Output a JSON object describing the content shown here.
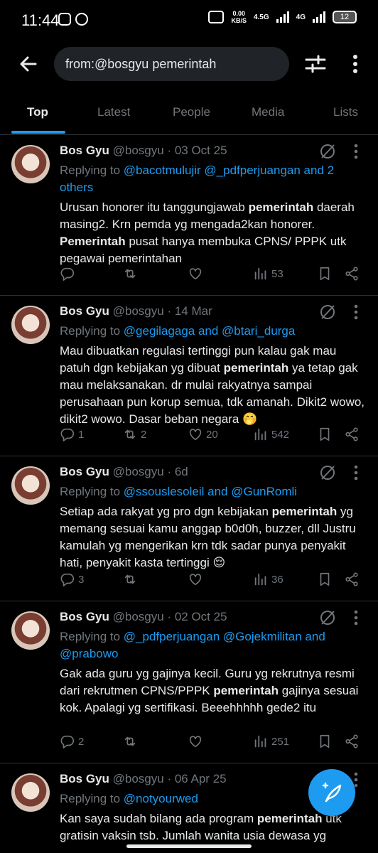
{
  "status": {
    "time": "11:44",
    "kbs_value": "0.00",
    "kbs_unit": "KB/S",
    "net1": "4.5G",
    "net2": "4G",
    "battery": "12"
  },
  "search": {
    "query": "from:@bosgyu pemerintah"
  },
  "tabs": [
    "Top",
    "Latest",
    "People",
    "Media",
    "Lists"
  ],
  "colors": {
    "accent": "#1d9bf0",
    "background": "#000000",
    "muted": "#71767b"
  },
  "tweets": [
    {
      "name": "Bos Gyu",
      "meta": "@bosgyu · 03 Oct 25",
      "replying_prefix": "Replying to ",
      "replying_to": "@bacotmulujir @_pdfperjuangan and 2 others",
      "body": [
        {
          "t": "Urusan honorer itu tanggungjawab "
        },
        {
          "b": "pemerintah"
        },
        {
          "t": " daerah masing2. Krn pemda yg mengada2kan honorer. "
        },
        {
          "b": "Pemerintah"
        },
        {
          "t": " pusat hanya membuka CPNS/ PPPK utk pegawai pemerintahan"
        }
      ],
      "replies": "",
      "reposts": "",
      "likes": "",
      "views": "53"
    },
    {
      "name": "Bos Gyu",
      "meta": "@bosgyu · 14 Mar",
      "replying_prefix": "Replying to ",
      "replying_to": "@gegilagaga and @btari_durga",
      "body": [
        {
          "t": "Mau dibuatkan regulasi tertinggi pun kalau gak mau patuh dgn kebijakan yg dibuat "
        },
        {
          "b": "pemerintah"
        },
        {
          "t": " ya tetap gak mau melaksanakan. dr mulai rakyatnya sampai perusahaan pun korup semua, tdk amanah. Dikit2 wowo, dikit2 wowo. Dasar beban negara 🤭"
        }
      ],
      "replies": "1",
      "reposts": "2",
      "likes": "20",
      "views": "542"
    },
    {
      "name": "Bos Gyu",
      "meta": "@bosgyu · 6d",
      "replying_prefix": "Replying to ",
      "replying_to": "@ssouslesoleil and @GunRomli",
      "body": [
        {
          "t": "Setiap ada rakyat yg pro dgn kebijakan "
        },
        {
          "b": "pemerintah"
        },
        {
          "t": " yg memang sesuai kamu anggap b0d0h, buzzer, dll Justru kamulah yg mengerikan krn tdk sadar punya penyakit hati, penyakit kasta tertinggi 😌"
        }
      ],
      "replies": "3",
      "reposts": "",
      "likes": "",
      "views": "36"
    },
    {
      "name": "Bos Gyu",
      "meta": "@bosgyu · 02 Oct 25",
      "replying_prefix": "Replying to ",
      "replying_to": "@_pdfperjuangan @Gojekmilitan and @prabowo",
      "body": [
        {
          "t": "Gak ada guru yg gajinya kecil. Guru yg rekrutnya resmi dari rekrutmen CPNS/PPPK "
        },
        {
          "b": "pemerintah"
        },
        {
          "t": " gajinya sesuai kok. Apalagi yg sertifikasi. Beeehhhhh gede2 itu"
        }
      ],
      "replies": "2",
      "reposts": "",
      "likes": "",
      "views": "251"
    },
    {
      "name": "Bos Gyu",
      "meta": "@bosgyu · 06 Apr 25",
      "replying_prefix": "Replying to ",
      "replying_to": "@notyourwed",
      "body": [
        {
          "t": "Kan saya sudah bilang ada program "
        },
        {
          "b": "pemerintah"
        },
        {
          "t": " utk gratisin vaksin tsb. Jumlah wanita usia dewasa yg"
        }
      ],
      "replies": "",
      "reposts": "",
      "likes": "",
      "views": ""
    }
  ]
}
